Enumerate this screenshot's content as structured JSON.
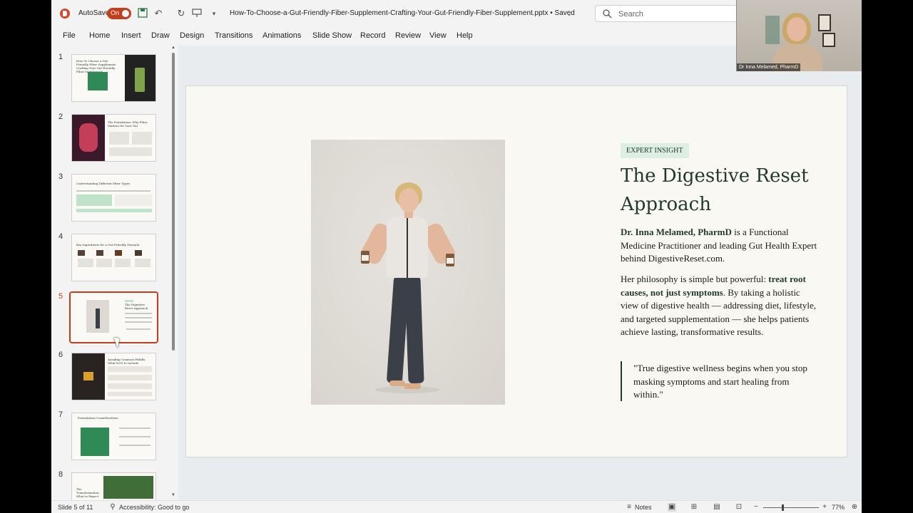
{
  "titlebar": {
    "autosave_label": "AutoSave",
    "autosave_state": "On",
    "document_title": "How-To-Choose-a-Gut-Friendly-Fiber-Supplement-Crafting-Your-Gut-Friendly-Fiber-Supplement.pptx • Saved",
    "search_placeholder": "Search"
  },
  "webcam": {
    "name": "Dr Inna Melamed, PharmD"
  },
  "menu": [
    "File",
    "Home",
    "Insert",
    "Draw",
    "Design",
    "Transitions",
    "Animations",
    "Slide Show",
    "Record",
    "Review",
    "View",
    "Help"
  ],
  "thumbnails": {
    "numbers": [
      "1",
      "2",
      "3",
      "4",
      "5",
      "6",
      "7",
      "8"
    ],
    "selected": "5",
    "titles": [
      "How To Choose a Gut-Friendly Fiber Supplement: Crafting Your Gut-Friendly Fiber Supplement",
      "The Foundation: Why Fiber Matters for Your Gut",
      "Understanding Different Fiber Types",
      "Key Ingredients for a Gut-Friendly Formula",
      "The Digestive Reset Approach",
      "Avoiding Common Pitfalls: What NOT to Include",
      "Formulation Considerations",
      "The Transformation: What to Expect"
    ]
  },
  "slide": {
    "badge": "EXPERT INSIGHT",
    "title": "The Digestive Reset Approach",
    "para1_strong": "Dr. Inna Melamed, PharmD",
    "para1_rest": " is a Functional Medicine Practitioner and leading Gut Health Expert behind DigestiveReset.com.",
    "para2_lead": "Her philosophy is simple but powerful: ",
    "para2_strong": "treat root causes, not just symptoms",
    "para2_rest": ". By taking a holistic view of digestive health — addressing diet, lifestyle, and targeted supplementation — she helps patients achieve lasting, transformative results.",
    "quote": "\"True digestive wellness begins when you stop masking symptoms and start healing from within.\""
  },
  "statusbar": {
    "slide_indicator": "Slide 5 of 11",
    "accessibility": "Accessibility: Good to go",
    "notes": "Notes",
    "zoom": "77%"
  },
  "colors": {
    "accent": "#c43e1c",
    "slide_green": "#1f3a2a",
    "badge_bg": "#ddeee2"
  }
}
